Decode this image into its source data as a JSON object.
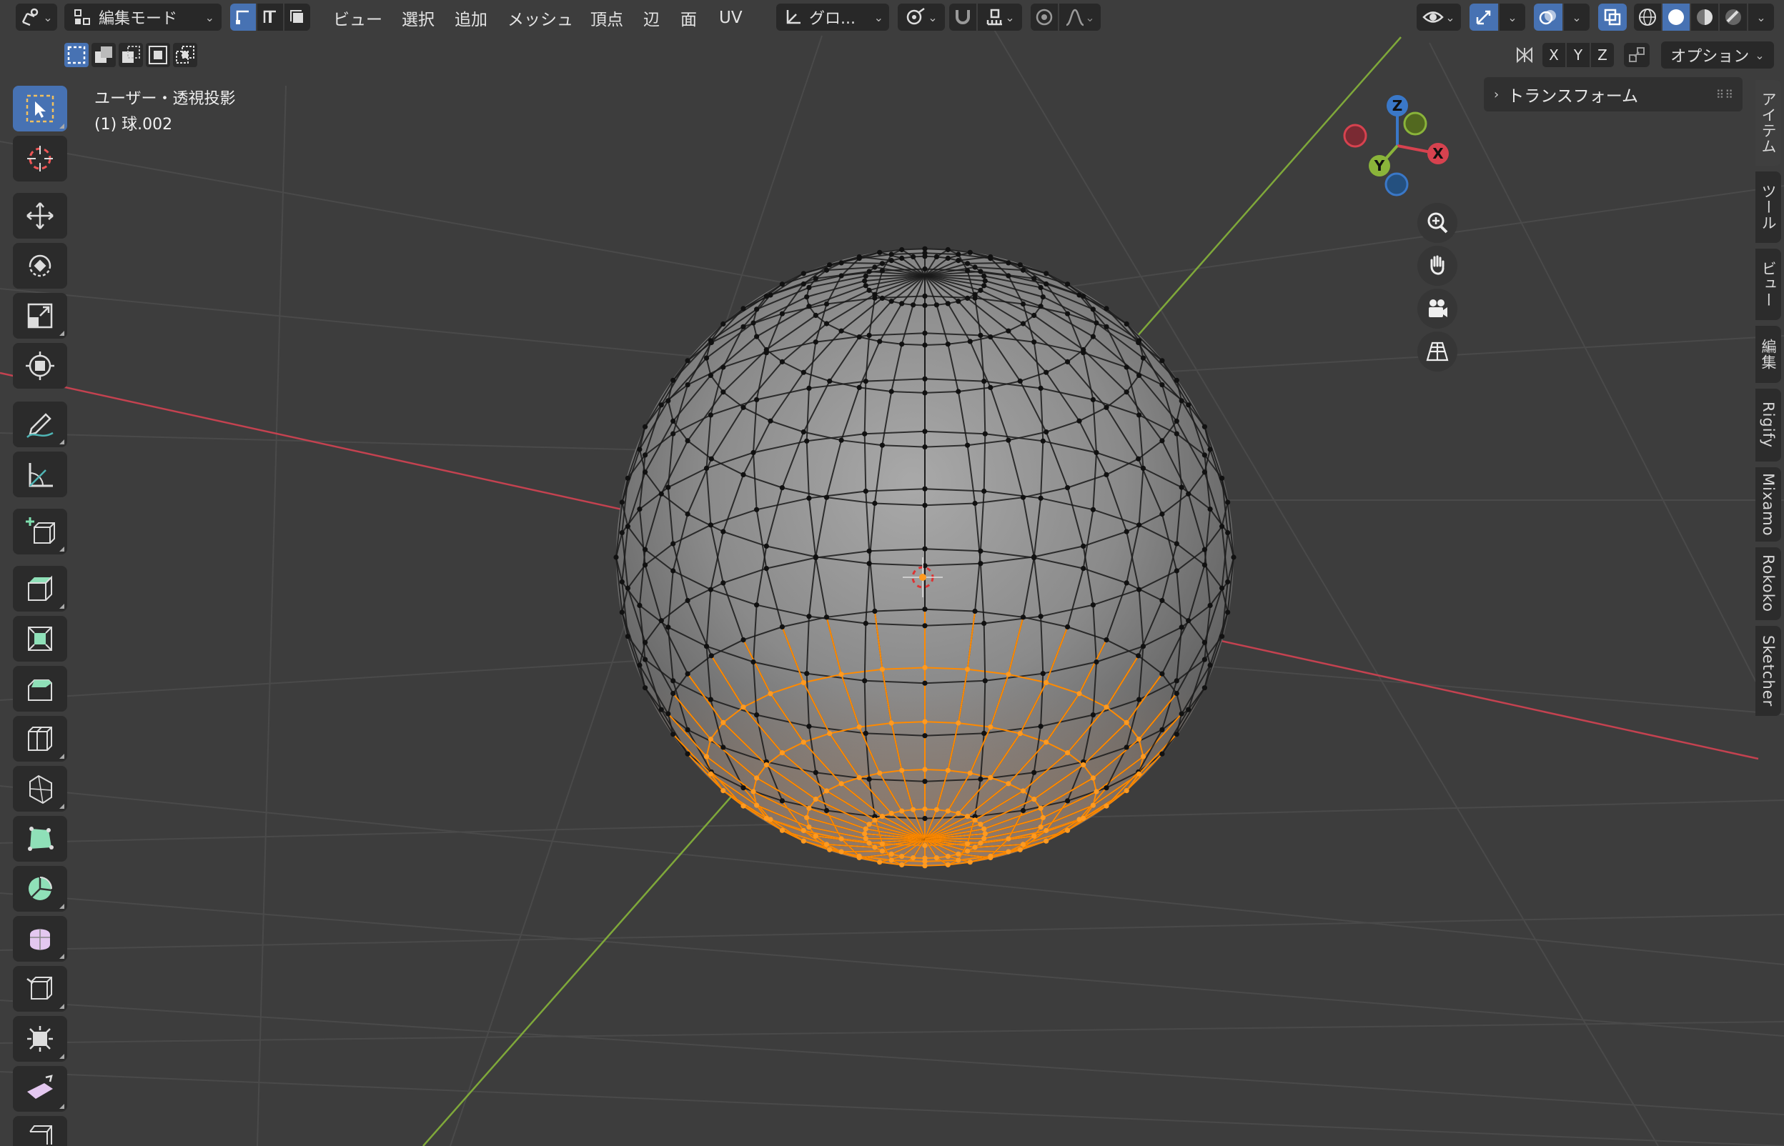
{
  "header": {
    "mode_label": "編集モード",
    "menus": [
      "ビュー",
      "選択",
      "追加",
      "メッシュ",
      "頂点",
      "辺",
      "面",
      "UV"
    ],
    "orientation_label": "グロ...",
    "axis_x": "X",
    "axis_y": "Y",
    "axis_z": "Z",
    "options_label": "オプション"
  },
  "viewport": {
    "view_name": "ユーザー・透視投影",
    "object_info": "(1) 球.002"
  },
  "gizmo": {
    "x": "X",
    "y": "Y",
    "z": "Z"
  },
  "npanel": {
    "transform_label": "トランスフォーム",
    "tabs": [
      "アイテム",
      "ツール",
      "ビュー",
      "編集",
      "Rigify",
      "Mixamo",
      "Rokoko",
      "Sketcher"
    ]
  },
  "colors": {
    "accent": "#4772b3",
    "selected": "#ff8a00",
    "x_axis": "#d7424f",
    "y_axis": "#8ab43a",
    "z_axis": "#3a78c8",
    "background": "#3d3d3d"
  }
}
